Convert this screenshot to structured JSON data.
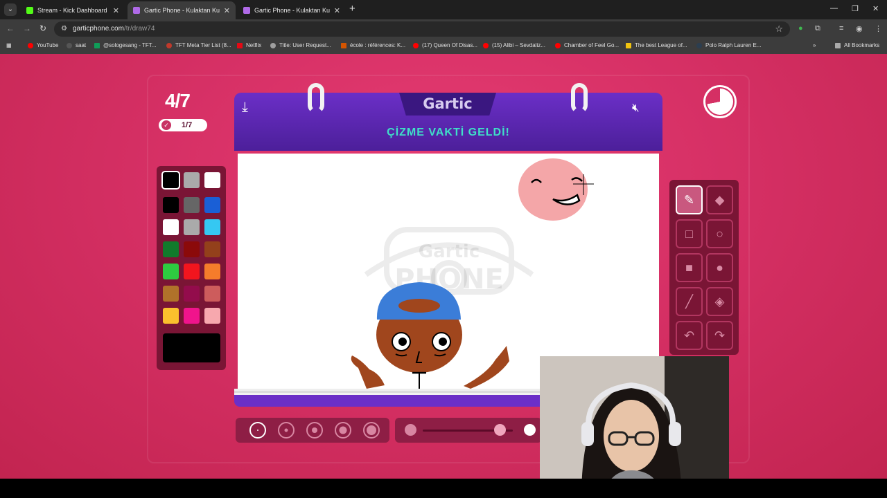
{
  "browser": {
    "tabs": [
      {
        "title": "Stream - Kick Dashboard",
        "active": false,
        "favicon_color": "#53fc18"
      },
      {
        "title": "Gartic Phone - Kulaktan Kulağa",
        "active": true,
        "favicon_color": "#b06ae8"
      },
      {
        "title": "Gartic Phone - Kulaktan Kulağa",
        "active": false,
        "favicon_color": "#b06ae8"
      }
    ],
    "url_host": "garticphone.com",
    "url_path": "/tr/draw74",
    "bookmarks": [
      {
        "label": "YouTube",
        "color": "#ff0000"
      },
      {
        "label": "saat",
        "color": "#444444"
      },
      {
        "label": "@sologesang - TFT...",
        "color": "#0f9d58"
      },
      {
        "label": "TFT Meta Tier List (8...",
        "color": "#c0392b"
      },
      {
        "label": "Netflix",
        "color": "#e50914"
      },
      {
        "label": "Title: User Request...",
        "color": "#9e9e9e"
      },
      {
        "label": "école : références: K...",
        "color": "#d35400"
      },
      {
        "label": "(17) Queen Of Disas...",
        "color": "#ff0000"
      },
      {
        "label": "(15) Alibi – Sevdaliz...",
        "color": "#ff0000"
      },
      {
        "label": "Chamber of Feel Go...",
        "color": "#ff0000"
      },
      {
        "label": "The best League of...",
        "color": "#f1c40f"
      },
      {
        "label": "Polo Ralph Lauren E...",
        "color": "#2c3e50"
      }
    ],
    "all_bookmarks": "All Bookmarks"
  },
  "game": {
    "round": "4/7",
    "done_count": "1/7",
    "brand": "Gartic",
    "instruction": "ÇİZME VAKTİ GELDİ!",
    "timer_fraction_elapsed": 0.28,
    "watermark_text": "Gartic PHONE"
  },
  "palette": {
    "colors": [
      "#000000",
      "#aaaaaa",
      "#ffffff",
      "#000000",
      "#666666",
      "#1a5fd6",
      "#ffffff",
      "#aaaaaa",
      "#35c8f2",
      "#117a2b",
      "#8b0a0a",
      "#93401b",
      "#2ecc40",
      "#f2151e",
      "#f57c2b",
      "#b0722a",
      "#930c4c",
      "#cd5c5c",
      "#fbc02d",
      "#f0148c",
      "#f7a8ae"
    ],
    "selected_index": 0,
    "current": "#000000"
  },
  "tools": [
    {
      "name": "pen-tool",
      "glyph": "✎",
      "active": true
    },
    {
      "name": "eraser-tool",
      "glyph": "◆",
      "active": false
    },
    {
      "name": "rectangle-outline-tool",
      "glyph": "□",
      "active": false
    },
    {
      "name": "ellipse-outline-tool",
      "glyph": "○",
      "active": false
    },
    {
      "name": "rectangle-fill-tool",
      "glyph": "■",
      "active": false
    },
    {
      "name": "ellipse-fill-tool",
      "glyph": "●",
      "active": false
    },
    {
      "name": "line-tool",
      "glyph": "╱",
      "active": false
    },
    {
      "name": "fill-bucket-tool",
      "glyph": "◈",
      "active": false
    },
    {
      "name": "undo-tool",
      "glyph": "↶",
      "active": false
    },
    {
      "name": "redo-tool",
      "glyph": "↷",
      "active": false
    }
  ],
  "brush_sizes": {
    "count": 5,
    "selected_index": 0
  },
  "opacity": {
    "value": 0.85
  }
}
